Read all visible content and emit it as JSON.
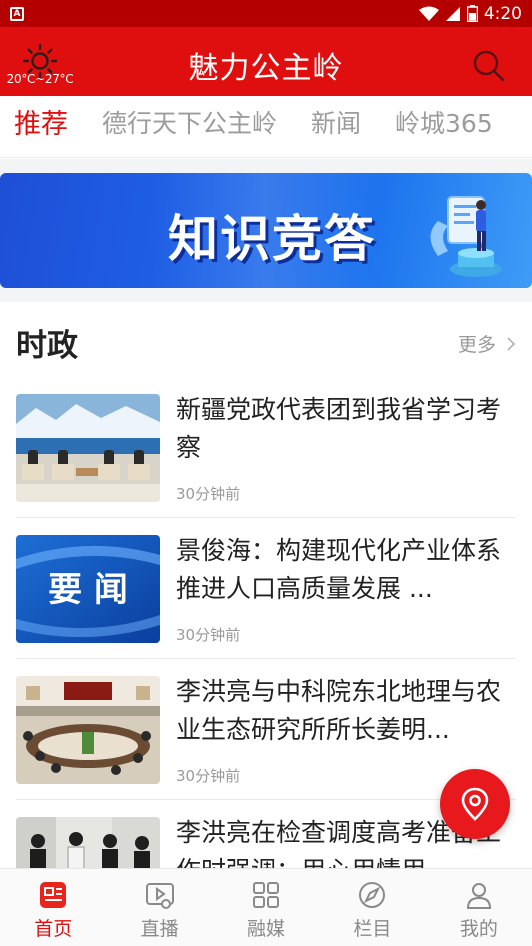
{
  "status_bar": {
    "time": "4:20"
  },
  "header": {
    "title": "魅力公主岭",
    "weather_temp": "20°C~27°C"
  },
  "tabs": [
    {
      "label": "推荐",
      "active": true
    },
    {
      "label": "德行天下公主岭",
      "active": false
    },
    {
      "label": "新闻",
      "active": false
    },
    {
      "label": "岭城365",
      "active": false
    }
  ],
  "banner": {
    "text": "知识竞答"
  },
  "section": {
    "title": "时政",
    "more_label": "更多"
  },
  "news": [
    {
      "title": "新疆党政代表团到我省学习考察",
      "time": "30分钟前",
      "thumb": "meeting-lake"
    },
    {
      "title": "景俊海：构建现代化产业体系 推进人口高质量发展 ...",
      "time": "30分钟前",
      "thumb": "yaowen",
      "thumb_text": "要 闻"
    },
    {
      "title": "李洪亮与中科院东北地理与农业生态研究所所长姜明...",
      "time": "30分钟前",
      "thumb": "conference-room"
    },
    {
      "title": "李洪亮在检查调度高考准备工作时强调：用心用情用...",
      "time": "",
      "thumb": "inspection"
    }
  ],
  "bottom_nav": [
    {
      "label": "首页",
      "icon": "home-news-icon",
      "active": true
    },
    {
      "label": "直播",
      "icon": "live-icon",
      "active": false
    },
    {
      "label": "融媒",
      "icon": "media-grid-icon",
      "active": false
    },
    {
      "label": "栏目",
      "icon": "column-icon",
      "active": false
    },
    {
      "label": "我的",
      "icon": "profile-icon",
      "active": false
    }
  ],
  "colors": {
    "brand_red": "#e00f0f",
    "status_bar": "#b50000",
    "banner_blue": "#1e63e8"
  }
}
